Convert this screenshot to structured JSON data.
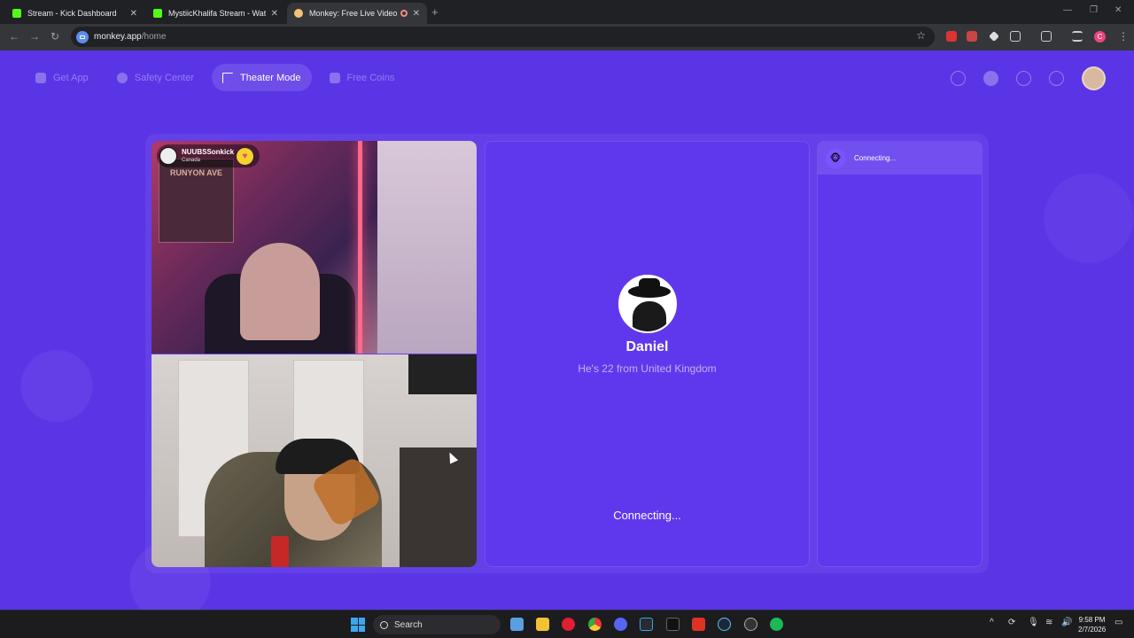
{
  "browser": {
    "tabs": [
      {
        "title": "Stream - Kick Dashboard",
        "favicon": "kick-icon"
      },
      {
        "title": "MystiicKhalifa Stream - Watch L",
        "favicon": "kick-icon"
      },
      {
        "title": "Monkey: Free Live Video Ch",
        "favicon": "monkey-icon",
        "active": true
      }
    ],
    "url_host": "monkey.app",
    "url_path": "/home"
  },
  "nav": {
    "items": [
      {
        "label": "Get App",
        "icon": "phone-icon"
      },
      {
        "label": "Safety Center",
        "icon": "shield-icon"
      },
      {
        "label": "Theater Mode",
        "icon": "expand-icon",
        "active": true
      },
      {
        "label": "Free Coins",
        "icon": "coins-icon"
      }
    ],
    "right_icons": [
      "search-icon",
      "coin-avatar-icon",
      "history-icon",
      "chat-icon",
      "profile-avatar"
    ]
  },
  "video": {
    "remote_user": "NUUBSSonkick",
    "remote_country": "Canada",
    "poster_text": "RUNYON AVE"
  },
  "partner": {
    "name": "Daniel",
    "info": "He's 22 from United Kingdom",
    "status": "Connecting..."
  },
  "chat": {
    "status": "Connecting..."
  },
  "taskbar": {
    "search_label": "Search",
    "time": "9:58 PM",
    "date": "2/7/2026"
  },
  "colors": {
    "page_bg": "#5a35e6",
    "panel_bg": "#5f38ee",
    "kick_green": "#53fc18"
  }
}
